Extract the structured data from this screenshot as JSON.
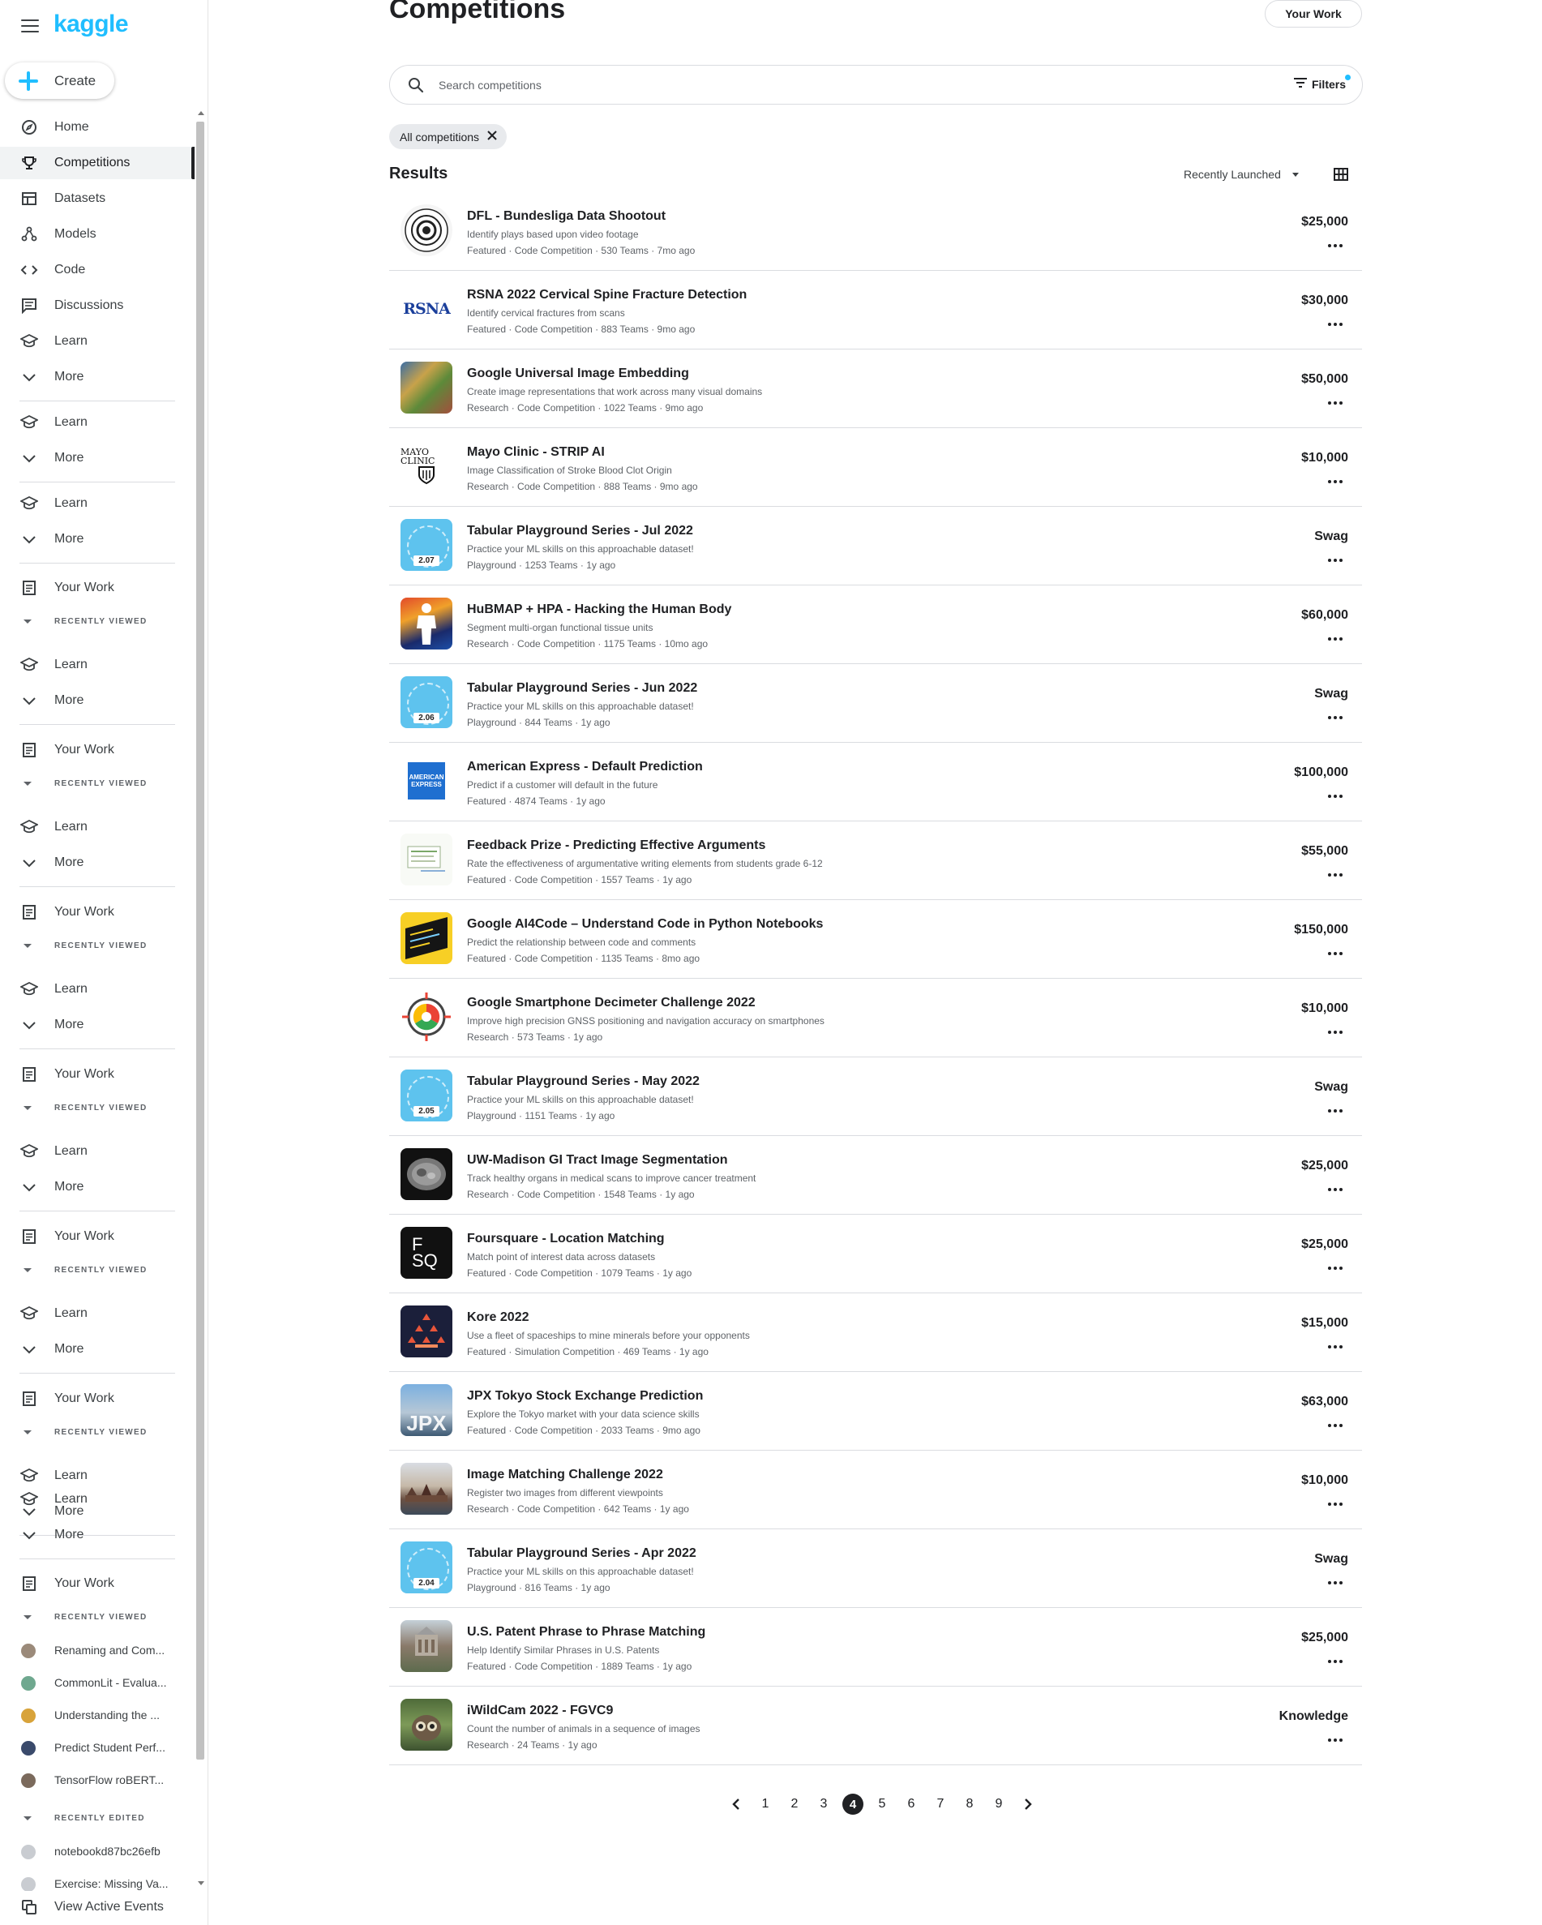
{
  "sidebar": {
    "logo": "kaggle",
    "create_label": "Create",
    "nav": {
      "home": "Home",
      "competitions": "Competitions",
      "datasets": "Datasets",
      "models": "Models",
      "code": "Code",
      "discussions": "Discussions",
      "learn": "Learn",
      "more": "More",
      "your_work": "Your Work",
      "recently_viewed": "RECENTLY VIEWED",
      "recently_edited": "RECENTLY EDITED",
      "view_active_events": "View Active Events"
    },
    "recently_viewed": [
      "Renaming and Com...",
      "CommonLit - Evalua...",
      "Understanding the ...",
      "Predict Student Perf...",
      "TensorFlow roBERT..."
    ],
    "recently_edited": [
      "notebookd87bc26efb",
      "Exercise: Missing Va..."
    ]
  },
  "header": {
    "title": "Competitions",
    "your_work_button": "Your Work"
  },
  "search": {
    "placeholder": "Search competitions",
    "value": "",
    "filters_label": "Filters"
  },
  "chip": {
    "label": "All competitions"
  },
  "results": {
    "heading": "Results",
    "sort_label": "Recently Launched",
    "items": [
      {
        "title": "DFL - Bundesliga Data Shootout",
        "desc": "Identify plays based upon video footage",
        "meta": "Featured · Code Competition · 530 Teams · 7mo ago",
        "prize": "$25,000",
        "thumb": "dfl"
      },
      {
        "title": "RSNA 2022 Cervical Spine Fracture Detection",
        "desc": "Identify cervical fractures from scans",
        "meta": "Featured · Code Competition · 883 Teams · 9mo ago",
        "prize": "$30,000",
        "thumb": "rsna",
        "thumb_text": "RSNA"
      },
      {
        "title": "Google Universal Image Embedding",
        "desc": "Create image representations that work across many visual domains",
        "meta": "Research · Code Competition · 1022 Teams · 9mo ago",
        "prize": "$50,000",
        "thumb": "guie"
      },
      {
        "title": "Mayo Clinic - STRIP AI",
        "desc": "Image Classification of Stroke Blood Clot Origin",
        "meta": "Research · Code Competition · 888 Teams · 9mo ago",
        "prize": "$10,000",
        "thumb": "mayo",
        "thumb_text": "MAYO CLINIC"
      },
      {
        "title": "Tabular Playground Series - Jul 2022",
        "desc": "Practice your ML skills on this approachable dataset!",
        "meta": "Playground · 1253 Teams · 1y ago",
        "prize": "Swag",
        "thumb": "tab",
        "thumb_text": "2.07"
      },
      {
        "title": "HuBMAP + HPA - Hacking the Human Body",
        "desc": "Segment multi-organ functional tissue units",
        "meta": "Research · Code Competition · 1175 Teams · 10mo ago",
        "prize": "$60,000",
        "thumb": "hub"
      },
      {
        "title": "Tabular Playground Series - Jun 2022",
        "desc": "Practice your ML skills on this approachable dataset!",
        "meta": "Playground · 844 Teams · 1y ago",
        "prize": "Swag",
        "thumb": "tab",
        "thumb_text": "2.06"
      },
      {
        "title": "American Express - Default Prediction",
        "desc": "Predict if a customer will default in the future",
        "meta": "Featured · 4874 Teams · 1y ago",
        "prize": "$100,000",
        "thumb": "amex",
        "thumb_text": "AMERICAN EXPRESS"
      },
      {
        "title": "Feedback Prize - Predicting Effective Arguments",
        "desc": "Rate the effectiveness of argumentative writing elements from students grade 6-12",
        "meta": "Featured · Code Competition · 1557 Teams · 1y ago",
        "prize": "$55,000",
        "thumb": "feed"
      },
      {
        "title": "Google AI4Code – Understand Code in Python Notebooks",
        "desc": "Predict the relationship between code and comments",
        "meta": "Featured · Code Competition · 1135 Teams · 8mo ago",
        "prize": "$150,000",
        "thumb": "ai4"
      },
      {
        "title": "Google Smartphone Decimeter Challenge 2022",
        "desc": "Improve high precision GNSS positioning and navigation accuracy on smartphones",
        "meta": "Research · 573 Teams · 1y ago",
        "prize": "$10,000",
        "thumb": "gsdc"
      },
      {
        "title": "Tabular Playground Series - May 2022",
        "desc": "Practice your ML skills on this approachable dataset!",
        "meta": "Playground · 1151 Teams · 1y ago",
        "prize": "Swag",
        "thumb": "tab",
        "thumb_text": "2.05"
      },
      {
        "title": "UW-Madison GI Tract Image Segmentation",
        "desc": "Track healthy organs in medical scans to improve cancer treatment",
        "meta": "Research · Code Competition · 1548 Teams · 1y ago",
        "prize": "$25,000",
        "thumb": "uw"
      },
      {
        "title": "Foursquare - Location Matching",
        "desc": "Match point of interest data across datasets",
        "meta": "Featured · Code Competition · 1079 Teams · 1y ago",
        "prize": "$25,000",
        "thumb": "fsq",
        "thumb_text": "F SQ"
      },
      {
        "title": "Kore 2022",
        "desc": "Use a fleet of spaceships to mine minerals before your opponents",
        "meta": "Featured · Simulation Competition · 469 Teams · 1y ago",
        "prize": "$15,000",
        "thumb": "kore"
      },
      {
        "title": "JPX Tokyo Stock Exchange Prediction",
        "desc": "Explore the Tokyo market with your data science skills",
        "meta": "Featured · Code Competition · 2033 Teams · 9mo ago",
        "prize": "$63,000",
        "thumb": "jpx",
        "thumb_text": "JPX"
      },
      {
        "title": "Image Matching Challenge 2022",
        "desc": "Register two images from different viewpoints",
        "meta": "Research · Code Competition · 642 Teams · 1y ago",
        "prize": "$10,000",
        "thumb": "imc"
      },
      {
        "title": "Tabular Playground Series - Apr 2022",
        "desc": "Practice your ML skills on this approachable dataset!",
        "meta": "Playground · 816 Teams · 1y ago",
        "prize": "Swag",
        "thumb": "tab",
        "thumb_text": "2.04"
      },
      {
        "title": "U.S. Patent Phrase to Phrase Matching",
        "desc": "Help Identify Similar Phrases in U.S. Patents",
        "meta": "Featured · Code Competition · 1889 Teams · 1y ago",
        "prize": "$25,000",
        "thumb": "uspto"
      },
      {
        "title": "iWildCam 2022 - FGVC9",
        "desc": "Count the number of animals in a sequence of images",
        "meta": "Research · 24 Teams · 1y ago",
        "prize": "Knowledge",
        "thumb": "iwild"
      }
    ]
  },
  "pagination": {
    "pages": [
      "1",
      "2",
      "3",
      "4",
      "5",
      "6",
      "7",
      "8",
      "9"
    ],
    "current": "4"
  },
  "colors": {
    "brand": "#20beff",
    "text": "#202124",
    "muted": "#5f6368",
    "divider": "#dadce0"
  }
}
